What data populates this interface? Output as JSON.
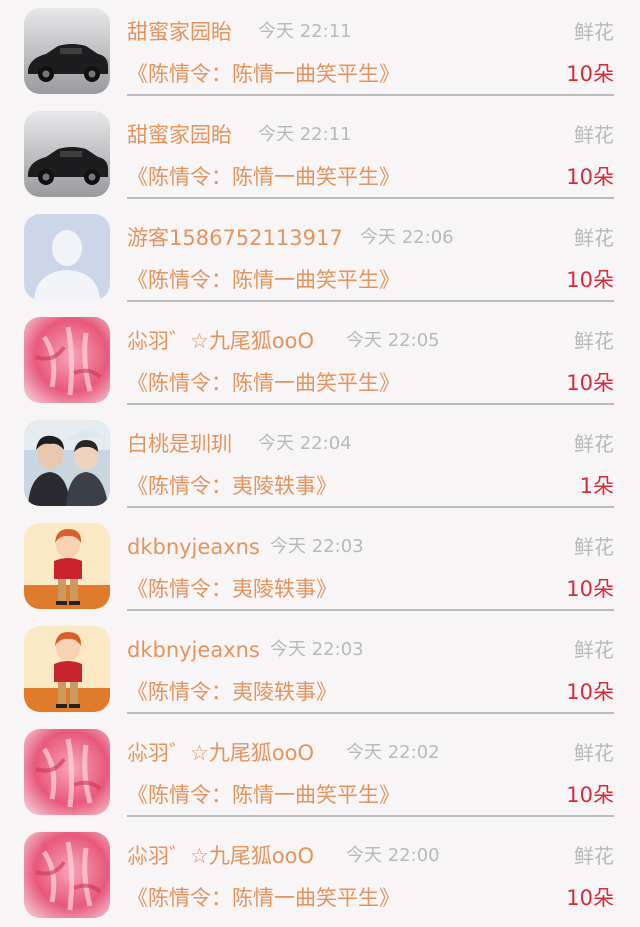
{
  "gift_label": "鲜花",
  "items": [
    {
      "avatar": "car-avatar",
      "name": "甜蜜家园眙",
      "time": "今天 22:11",
      "work": "《陈情令：陈情一曲笑平生》",
      "count": "10朵"
    },
    {
      "avatar": "car-avatar",
      "name": "甜蜜家园眙",
      "time": "今天 22:11",
      "work": "《陈情令：陈情一曲笑平生》",
      "count": "10朵"
    },
    {
      "avatar": "default-user-avatar",
      "name": "游客1586752113917",
      "time": "今天 22:06",
      "work": "《陈情令：陈情一曲笑平生》",
      "count": "10朵"
    },
    {
      "avatar": "pink-fur-avatar",
      "name": "尛羽゛☆九尾狐ooO",
      "time": "今天 22:05",
      "work": "《陈情令：陈情一曲笑平生》",
      "count": "10朵"
    },
    {
      "avatar": "duo-photo-avatar",
      "name": "白桃是玔玔",
      "time": "今天 22:04",
      "work": "《陈情令：夷陵轶事》",
      "count": "1朵"
    },
    {
      "avatar": "cartoon-person-avatar",
      "name": "dkbnyjeaxns",
      "time": "今天 22:03",
      "work": "《陈情令：夷陵轶事》",
      "count": "10朵"
    },
    {
      "avatar": "cartoon-person-avatar",
      "name": "dkbnyjeaxns",
      "time": "今天 22:03",
      "work": "《陈情令：夷陵轶事》",
      "count": "10朵"
    },
    {
      "avatar": "pink-fur-avatar",
      "name": "尛羽゛☆九尾狐ooO",
      "time": "今天 22:02",
      "work": "《陈情令：陈情一曲笑平生》",
      "count": "10朵"
    },
    {
      "avatar": "pink-fur-avatar",
      "name": "尛羽゛☆九尾狐ooO",
      "time": "今天 22:00",
      "work": "《陈情令：陈情一曲笑平生》",
      "count": "10朵"
    }
  ]
}
